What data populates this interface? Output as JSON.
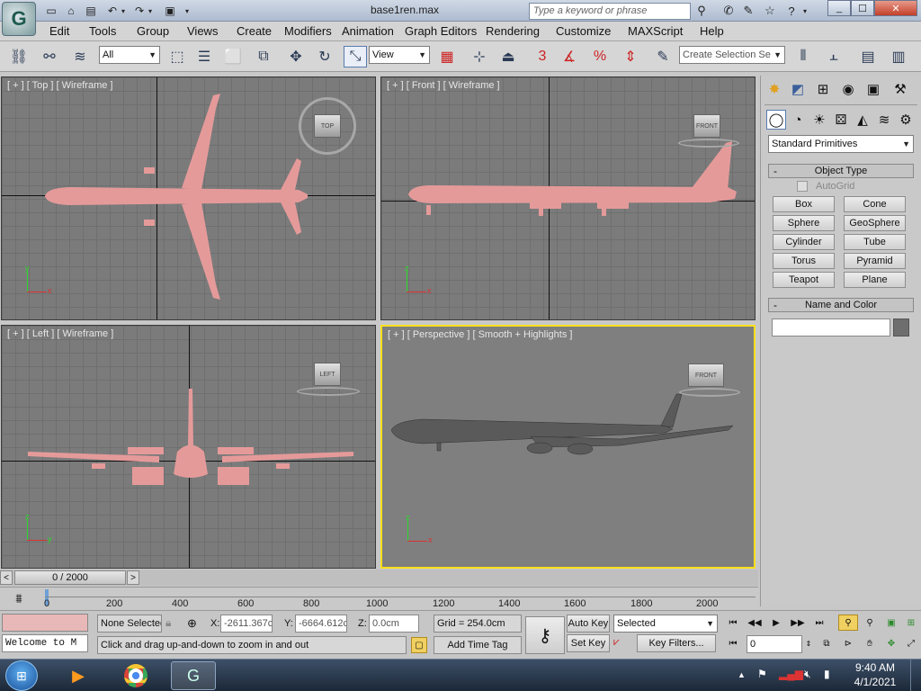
{
  "window": {
    "title": "base1ren.max",
    "search_placeholder": "Type a keyword or phrase",
    "controls": {
      "minimize": "_",
      "maximize": "☐",
      "close": "✕"
    }
  },
  "menu": [
    "Edit",
    "Tools",
    "Group",
    "Views",
    "Create",
    "Modifiers",
    "Animation",
    "Graph Editors",
    "Rendering",
    "Customize",
    "MAXScript",
    "Help"
  ],
  "toolbar": {
    "selection_filter": "All",
    "reference_coord": "View",
    "selection_set_placeholder": "Create Selection Se",
    "snaps_label": "3",
    "icons": [
      "select-and-link-icon",
      "unlink-icon",
      "bind-to-space-warp-icon",
      "select-object-icon",
      "select-by-name-icon",
      "rect-selection-icon",
      "window-crossing-icon",
      "move-icon",
      "rotate-icon",
      "scale-icon",
      "pivot-icon",
      "select-manipulate-icon",
      "keyboard-shortcut-icon",
      "snaps-icon",
      "angle-snap-icon",
      "percent-snap-icon",
      "spinner-snap-icon",
      "edit-named-selection-icon",
      "mirror-icon",
      "align-icon",
      "layer-manager-icon"
    ]
  },
  "viewports": [
    {
      "label": "[ + ] [ Top ] [ Wireframe ]",
      "cube": "TOP",
      "active": false
    },
    {
      "label": "[ + ] [ Front ] [ Wireframe ]",
      "cube": "FRONT",
      "active": false
    },
    {
      "label": "[ + ] [ Left ] [ Wireframe ]",
      "cube": "LEFT",
      "active": false
    },
    {
      "label": "[ + ] [ Perspective ] [ Smooth + Highlights ]",
      "cube": "FRONT",
      "active": true
    }
  ],
  "axis_labels": {
    "x": "x",
    "y": "y",
    "z": "z"
  },
  "command_panel": {
    "tabs": [
      "create-tab",
      "modify-tab",
      "hierarchy-tab",
      "motion-tab",
      "display-tab",
      "utilities-tab"
    ],
    "categories": [
      "geometry-icon",
      "shapes-icon",
      "lights-icon",
      "cameras-icon",
      "helpers-icon",
      "space-warps-icon",
      "systems-icon"
    ],
    "dropdown": "Standard Primitives",
    "object_type": {
      "title": "Object Type",
      "autogrid": "AutoGrid",
      "buttons": [
        "Box",
        "Cone",
        "Sphere",
        "GeoSphere",
        "Cylinder",
        "Tube",
        "Torus",
        "Pyramid",
        "Teapot",
        "Plane"
      ]
    },
    "name_color": {
      "title": "Name and Color",
      "name": ""
    }
  },
  "timeline": {
    "frame_counter": "0 / 2000",
    "ticks": [
      "0",
      "200",
      "400",
      "600",
      "800",
      "1000",
      "1200",
      "1400",
      "1600",
      "1800",
      "2000"
    ]
  },
  "status": {
    "maxscript_listener": "Welcome to M",
    "selection": "None Selected",
    "x_label": "X:",
    "x_value": "-2611.367c",
    "y_label": "Y:",
    "y_value": "-6664.612c",
    "z_label": "Z:",
    "z_value": "0.0cm",
    "grid": "Grid = 254.0cm",
    "prompt": "Click and drag up-and-down to zoom in and out",
    "add_time_tag": "Add Time Tag",
    "auto_key": "Auto Key",
    "set_key": "Set Key",
    "key_mode": "Selected",
    "key_filters": "Key Filters...",
    "current_frame": "0"
  },
  "taskbar": {
    "time": "9:40 AM",
    "date": "4/1/2021",
    "apps": [
      "windows-start-icon",
      "media-player-icon",
      "chrome-icon",
      "3ds-max-icon"
    ]
  }
}
